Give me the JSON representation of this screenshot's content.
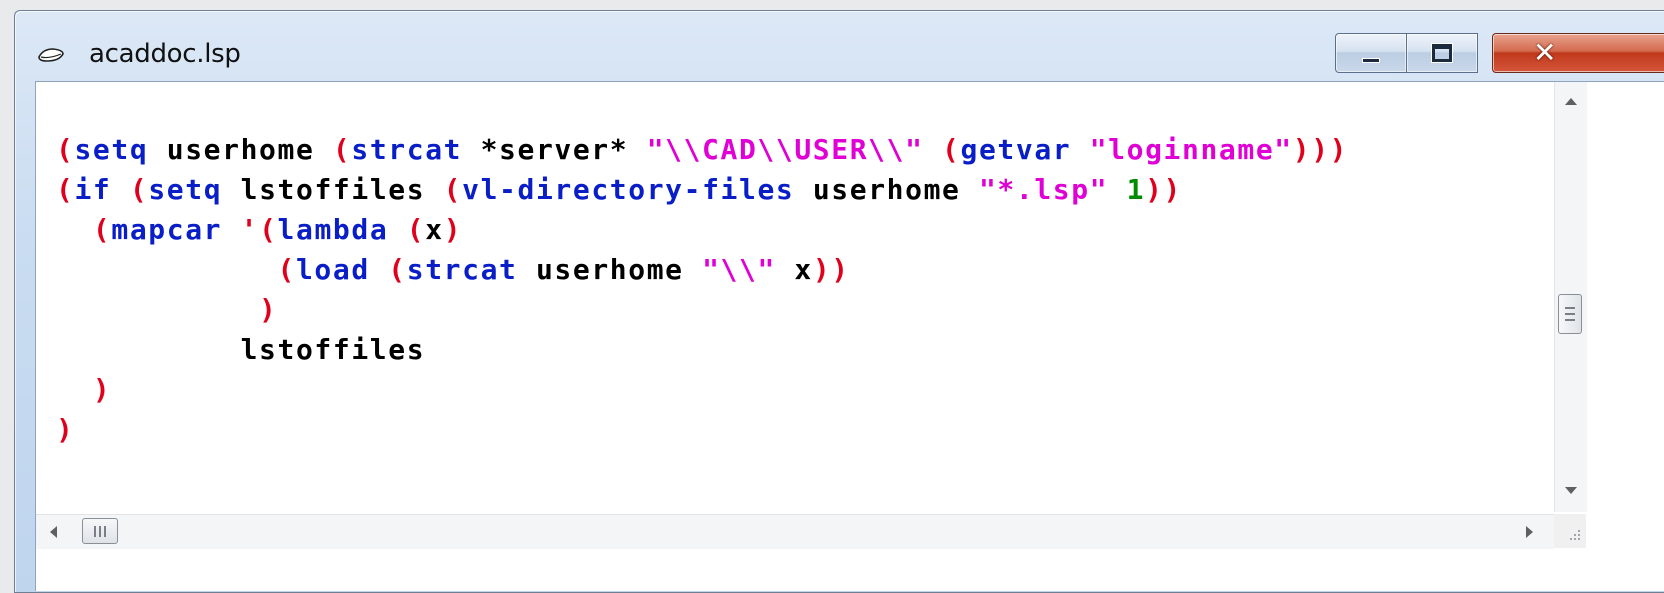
{
  "window": {
    "title": "acaddoc.lsp",
    "icon": "lisp-file-icon",
    "controls": {
      "minimize": "minimize-icon",
      "maximize": "maximize-icon",
      "close": "close-icon"
    }
  },
  "editor": {
    "language": "AutoLISP",
    "colors": {
      "paren": "#e0001b",
      "keyword": "#0a1ec8",
      "string": "#e000d6",
      "number": "#008a00",
      "identifier": "#000000"
    },
    "lines": [
      [
        [
          "p",
          "("
        ],
        [
          "k",
          "setq"
        ],
        [
          "v",
          " userhome "
        ],
        [
          "p",
          "("
        ],
        [
          "k",
          "strcat"
        ],
        [
          "v",
          " *server* "
        ],
        [
          "s",
          "\"\\\\CAD\\\\USER\\\\\""
        ],
        [
          "v",
          " "
        ],
        [
          "p",
          "("
        ],
        [
          "k",
          "getvar"
        ],
        [
          "v",
          " "
        ],
        [
          "s",
          "\"loginname\""
        ],
        [
          "p",
          ")))"
        ]
      ],
      [
        [
          "p",
          "("
        ],
        [
          "k",
          "if"
        ],
        [
          "v",
          " "
        ],
        [
          "p",
          "("
        ],
        [
          "k",
          "setq"
        ],
        [
          "v",
          " lstoffiles "
        ],
        [
          "p",
          "("
        ],
        [
          "k",
          "vl-directory-files"
        ],
        [
          "v",
          " userhome "
        ],
        [
          "s",
          "\"*.lsp\""
        ],
        [
          "v",
          " "
        ],
        [
          "n",
          "1"
        ],
        [
          "p",
          "))"
        ]
      ],
      [
        [
          "v",
          "  "
        ],
        [
          "p",
          "("
        ],
        [
          "k",
          "mapcar"
        ],
        [
          "v",
          " "
        ],
        [
          "p",
          "'("
        ],
        [
          "k",
          "lambda"
        ],
        [
          "v",
          " "
        ],
        [
          "p",
          "("
        ],
        [
          "v",
          "x"
        ],
        [
          "p",
          ")"
        ]
      ],
      [
        [
          "v",
          "            "
        ],
        [
          "p",
          "("
        ],
        [
          "k",
          "load"
        ],
        [
          "v",
          " "
        ],
        [
          "p",
          "("
        ],
        [
          "k",
          "strcat"
        ],
        [
          "v",
          " userhome "
        ],
        [
          "s",
          "\"\\\\\""
        ],
        [
          "v",
          " x"
        ],
        [
          "p",
          "))"
        ]
      ],
      [
        [
          "v",
          "           "
        ],
        [
          "p",
          ")"
        ]
      ],
      [
        [
          "v",
          "          lstoffiles"
        ]
      ],
      [
        [
          "v",
          "  "
        ],
        [
          "p",
          ")"
        ]
      ],
      [
        [
          "p",
          ")"
        ]
      ]
    ]
  },
  "scrollbars": {
    "vertical": {
      "up": "scroll-up-arrow",
      "down": "scroll-down-arrow",
      "thumb": "vertical-scroll-thumb"
    },
    "horizontal": {
      "left": "scroll-left-arrow",
      "right": "scroll-right-arrow",
      "thumb": "horizontal-scroll-thumb"
    }
  }
}
